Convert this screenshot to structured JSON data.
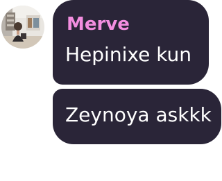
{
  "theme": {
    "bubble_color": "#2a2538",
    "text_color": "#ffffff",
    "sender_color": "#f38ee0"
  },
  "messages": [
    {
      "sender": "Merve",
      "text": "Hepinixe kun",
      "avatar": "profile-photo"
    },
    {
      "text": "Zeynoya askkk"
    }
  ]
}
